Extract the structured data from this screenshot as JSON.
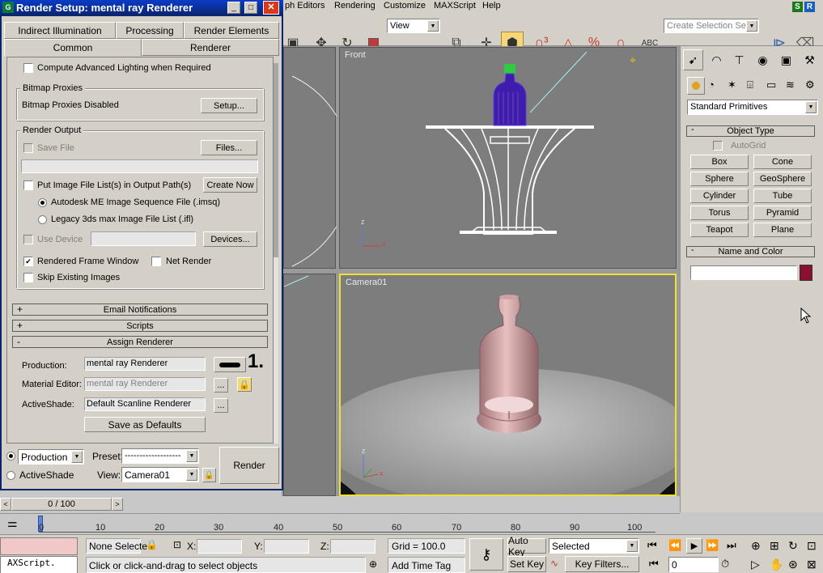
{
  "menubar": {
    "items": [
      "ph Editors",
      "Rendering",
      "Customize",
      "MAXScript",
      "Help"
    ],
    "right_badges": [
      "S",
      "R"
    ]
  },
  "toolbar": {
    "view_select": "View",
    "selection_set_placeholder": "Create Selection Set"
  },
  "dialog": {
    "title": "Render Setup: mental ray Renderer",
    "tabs_row1": [
      "Indirect Illumination",
      "Processing",
      "Render Elements"
    ],
    "tabs_row2": [
      "Common",
      "Renderer"
    ],
    "compute_lighting": "Compute Advanced Lighting when Required",
    "bitmap_proxies": {
      "title": "Bitmap Proxies",
      "status": "Bitmap Proxies Disabled",
      "setup_button": "Setup..."
    },
    "render_output": {
      "title": "Render Output",
      "save_file": "Save File",
      "files_button": "Files...",
      "put_image_list": "Put Image File List(s) in Output Path(s)",
      "create_now_button": "Create Now",
      "option_imsq": "Autodesk ME Image Sequence File (.imsq)",
      "option_ifl": "Legacy 3ds max Image File List (.ifl)",
      "use_device": "Use Device",
      "devices_button": "Devices...",
      "rendered_frame_window": "Rendered Frame Window",
      "net_render": "Net Render",
      "skip_existing": "Skip Existing Images"
    },
    "rollouts": {
      "email": "Email Notifications",
      "scripts": "Scripts",
      "assign": "Assign Renderer"
    },
    "assign_renderer": {
      "production_label": "Production:",
      "production_value": "mental ray Renderer",
      "material_label": "Material Editor:",
      "material_value": "mental ray Renderer",
      "activeshade_label": "ActiveShade:",
      "activeshade_value": "Default Scanline Renderer",
      "browse_button": "...",
      "save_defaults_button": "Save as Defaults",
      "annotation": "1."
    },
    "footer": {
      "mode_value": "Production",
      "activeshade": "ActiveShade",
      "preset_label": "Preset:",
      "preset_value": "-------------------",
      "view_label": "View:",
      "view_value": "Camera01",
      "render_button": "Render"
    }
  },
  "viewports": {
    "front_label": "Front",
    "camera_label": "Camera01"
  },
  "command_panel": {
    "category_select": "Standard Primitives",
    "object_type_title": "Object Type",
    "autogrid": "AutoGrid",
    "buttons": [
      "Box",
      "Cone",
      "Sphere",
      "GeoSphere",
      "Cylinder",
      "Tube",
      "Torus",
      "Pyramid",
      "Teapot",
      "Plane"
    ],
    "name_color_title": "Name and Color",
    "object_color": "#8b1030"
  },
  "timeline": {
    "slider_text": "0 / 100",
    "ticks": [
      "0",
      "10",
      "20",
      "30",
      "40",
      "50",
      "60",
      "70",
      "80",
      "90",
      "100"
    ]
  },
  "status": {
    "maxscript_text": "AXScript.",
    "none_selected": "None Selecte",
    "x_label": "X:",
    "y_label": "Y:",
    "z_label": "Z:",
    "grid": "Grid = 100.0",
    "prompt": "Click or click-and-drag to select objects",
    "add_time_tag": "Add Time Tag",
    "auto_key": "Auto Key",
    "set_key": "Set Key",
    "selected_value": "Selected",
    "key_filters": "Key Filters...",
    "frame_value": "0"
  }
}
